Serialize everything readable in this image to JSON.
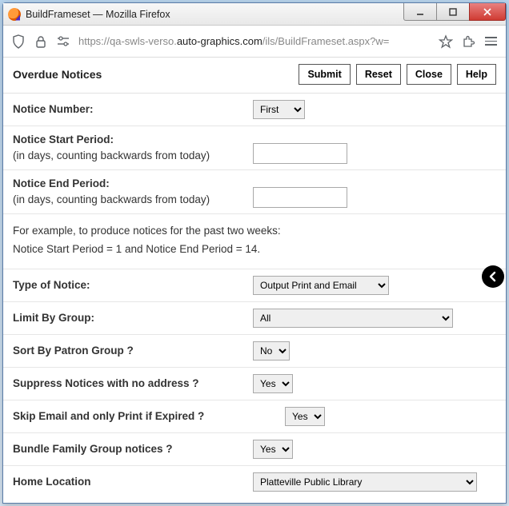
{
  "window": {
    "title": "BuildFrameset — Mozilla Firefox"
  },
  "address": {
    "prefix": "https://qa-swls-verso.",
    "domain": "auto-graphics.com",
    "suffix": "/ils/BuildFrameset.aspx?w="
  },
  "header": {
    "title": "Overdue Notices",
    "submit": "Submit",
    "reset": "Reset",
    "close": "Close",
    "help": "Help"
  },
  "fields": {
    "notice_number": {
      "label": "Notice Number:",
      "value": "First"
    },
    "notice_start": {
      "label_bold": "Notice Start Period:",
      "label_rest": "(in days, counting backwards from today)",
      "value": ""
    },
    "notice_end": {
      "label_bold": "Notice End Period:",
      "label_rest": "(in days, counting backwards from today)",
      "value": ""
    },
    "example_line1": "For example, to produce notices for the past two weeks:",
    "example_line2": "Notice Start Period = 1 and Notice End Period = 14.",
    "type_of_notice": {
      "label": "Type of Notice:",
      "value": "Output Print and Email"
    },
    "limit_by_group": {
      "label": "Limit By Group:",
      "value": "All"
    },
    "sort_by_patron": {
      "label": "Sort By Patron Group ?",
      "value": "No"
    },
    "suppress_no_addr": {
      "label": "Suppress Notices with no address ?",
      "value": "Yes"
    },
    "skip_email_expired": {
      "label": "Skip Email and only Print if Expired ?",
      "value": "Yes"
    },
    "bundle_family": {
      "label": "Bundle Family Group notices ?",
      "value": "Yes"
    },
    "home_location": {
      "label": "Home Location",
      "value": "Platteville Public Library"
    }
  }
}
